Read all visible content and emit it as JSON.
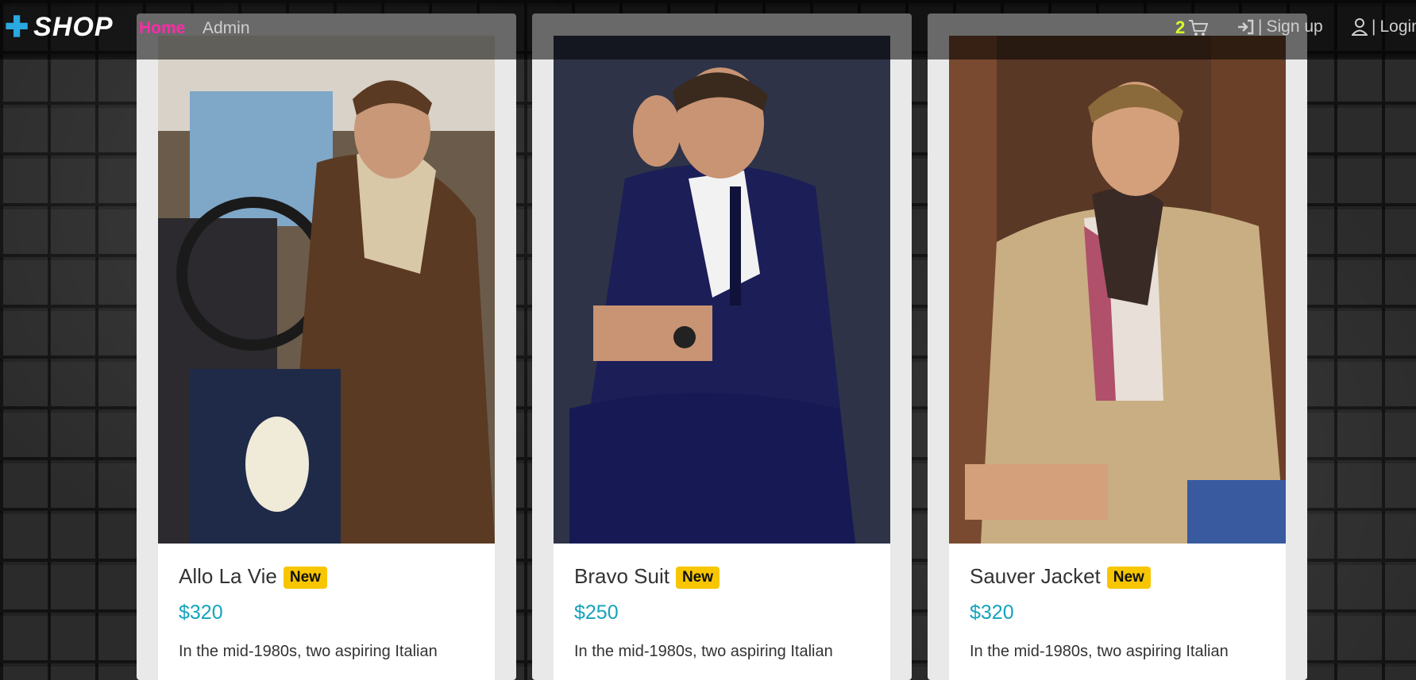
{
  "brand": {
    "plus_icon": "plus-icon",
    "name": "SHOP"
  },
  "nav": {
    "home": "Home",
    "admin": "Admin",
    "cart_count": "2",
    "separator": "|",
    "signup": "Sign up",
    "login": "Login"
  },
  "products": [
    {
      "title": "Allo La Vie",
      "badge": "New",
      "price": "$320",
      "description": "In the mid-1980s, two aspiring Italian"
    },
    {
      "title": "Bravo Suit",
      "badge": "New",
      "price": "$250",
      "description": "In the mid-1980s, two aspiring Italian"
    },
    {
      "title": "Sauver Jacket",
      "badge": "New",
      "price": "$320",
      "description": "In the mid-1980s, two aspiring Italian"
    }
  ],
  "colors": {
    "accent_home": "#ff2aa8",
    "cart_count": "#d7ff2a",
    "price": "#14a3bd",
    "badge": "#f7c600"
  }
}
